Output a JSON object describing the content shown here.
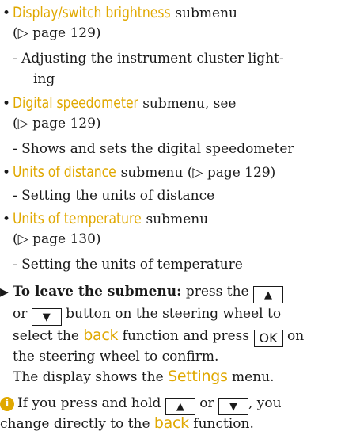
{
  "items": [
    {
      "title": "Display/switch brightness",
      "suffix": " submenu",
      "ref": "(▷ page 129)",
      "desc_lines": [
        "- Adjusting the instrument cluster light-",
        "ing"
      ]
    },
    {
      "title": "Digital speedometer",
      "suffix": " submenu, see",
      "ref": "(▷ page 129)",
      "desc_lines": [
        "- Shows and sets the digital speedometer"
      ]
    },
    {
      "title": "Units of distance",
      "suffix": " submenu (▷ page 129)",
      "desc_lines": [
        "- Setting the units of distance"
      ]
    },
    {
      "title": "Units of temperature",
      "suffix": " submenu",
      "ref": "(▷ page 130)",
      "desc_lines": [
        "- Setting the units of temperature"
      ]
    }
  ],
  "step": {
    "bullet": "▶",
    "lead": "To leave the submenu:",
    "t1": " press the ",
    "t2": "or ",
    "t3": " button on the steering wheel to",
    "t4": "select the ",
    "back": "back",
    "t5": " function and press ",
    "t6": " on",
    "t7": "the steering wheel to confirm.",
    "t8": "The display shows the ",
    "settings": "Settings",
    "t9": " menu."
  },
  "info": {
    "icon": "i",
    "t1": "If you press and hold ",
    "t2": " or ",
    "t3": ", you",
    "t4": "change directly to the ",
    "back": "back",
    "t5": " function."
  },
  "keys": {
    "up": "▲",
    "down": "▼",
    "ok": "OK"
  },
  "colors": {
    "highlight": "#e0a800",
    "text": "#1a1a1a"
  }
}
